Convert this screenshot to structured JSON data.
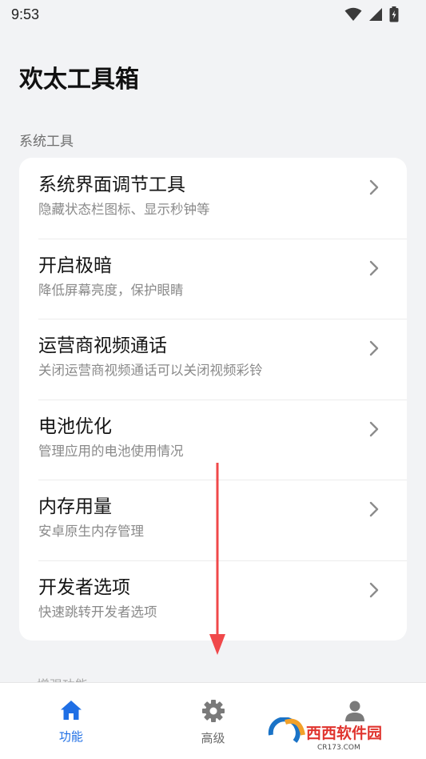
{
  "status_bar": {
    "time": "9:53"
  },
  "app": {
    "title": "欢太工具箱"
  },
  "section": {
    "title": "系统工具"
  },
  "items": [
    {
      "title": "系统界面调节工具",
      "subtitle": "隐藏状态栏图标、显示秒钟等"
    },
    {
      "title": "开启极暗",
      "subtitle": "降低屏幕亮度，保护眼睛"
    },
    {
      "title": "运营商视频通话",
      "subtitle": "关闭运营商视频通话可以关闭视频彩铃"
    },
    {
      "title": "电池优化",
      "subtitle": "管理应用的电池使用情况"
    },
    {
      "title": "内存用量",
      "subtitle": "安卓原生内存管理"
    },
    {
      "title": "开发者选项",
      "subtitle": "快速跳转开发者选项"
    }
  ],
  "next_section": {
    "title": "增强功能"
  },
  "bottom_nav": [
    {
      "label": "功能",
      "icon": "home-icon",
      "active": true
    },
    {
      "label": "高级",
      "icon": "gear-icon",
      "active": false
    },
    {
      "label": "",
      "icon": "person-icon",
      "active": false
    }
  ],
  "watermark": {
    "text": "西西软件园",
    "domain": "CR173.COM"
  },
  "colors": {
    "accent": "#1f6fe5",
    "annotation": "#f0484a",
    "background": "#f2f3f5"
  }
}
